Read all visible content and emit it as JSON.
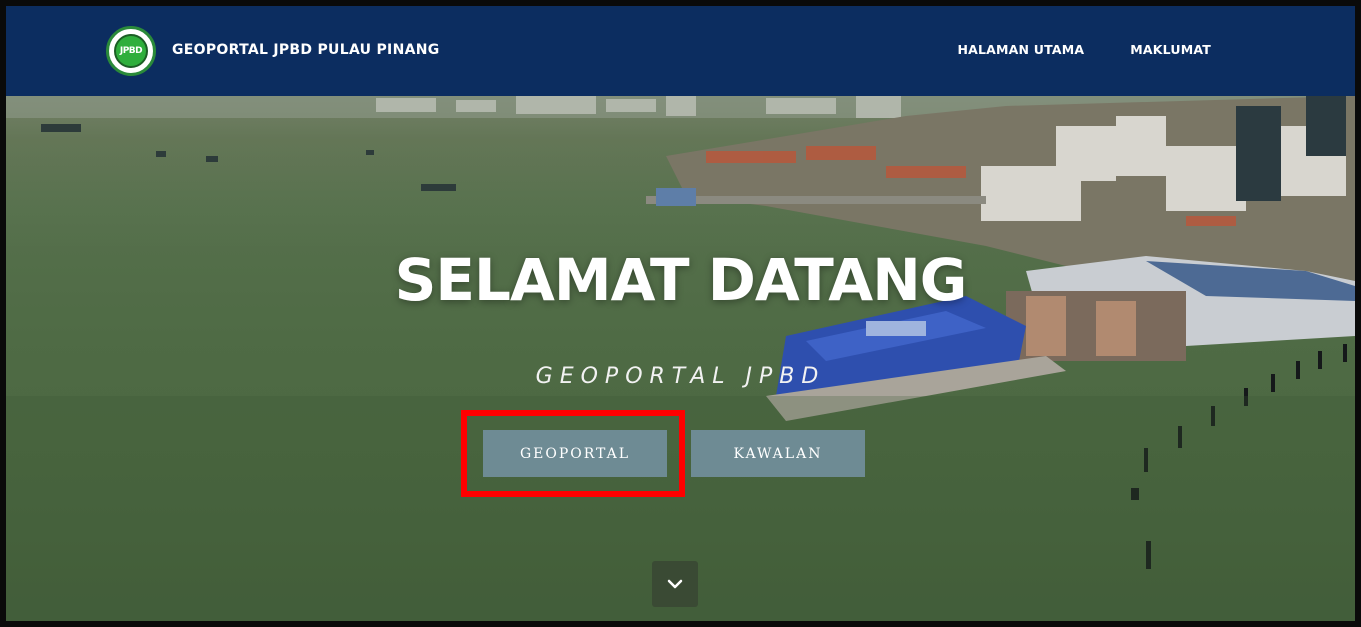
{
  "navbar": {
    "logo_text": "JPBD",
    "brand": "GEOPORTAL JPBD PULAU PINANG",
    "links": [
      {
        "label": "HALAMAN UTAMA"
      },
      {
        "label": "MAKLUMAT"
      }
    ]
  },
  "hero": {
    "title": "SELAMAT DATANG",
    "subtitle": "GEOPORTAL JPBD",
    "buttons": [
      {
        "label": "GEOPORTAL"
      },
      {
        "label": "KAWALAN"
      }
    ],
    "scroll_icon": "chevron-down-icon"
  },
  "colors": {
    "navbar_bg": "#0c2d60",
    "button_bg": "#6e8b94",
    "highlight": "#ff0000",
    "sea": "#4f6b45"
  }
}
